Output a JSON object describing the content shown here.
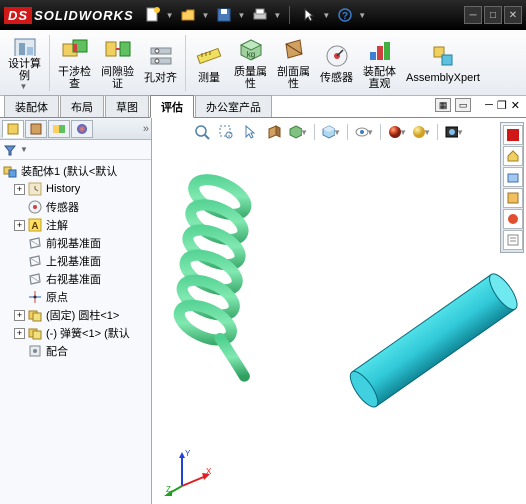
{
  "app": {
    "name": "SOLIDWORKS"
  },
  "ribbon": {
    "items": [
      {
        "label": "设计算\n例"
      },
      {
        "label": "干涉检\n查"
      },
      {
        "label": "间隙验\n证"
      },
      {
        "label": "孔对齐"
      },
      {
        "label": "测量"
      },
      {
        "label": "质量属\n性"
      },
      {
        "label": "剖面属\n性"
      },
      {
        "label": "传感器"
      },
      {
        "label": "装配体\n直观"
      },
      {
        "label": "AssemblyXpert"
      }
    ]
  },
  "tabs": {
    "items": [
      "装配体",
      "布局",
      "草图",
      "评估",
      "办公室产品"
    ],
    "active": 3
  },
  "tree": {
    "root": "装配体1 (默认<默认",
    "nodes": [
      {
        "icon": "history",
        "label": "History",
        "exp": "+",
        "ind": 1
      },
      {
        "icon": "sensor",
        "label": "传感器",
        "ind": 1
      },
      {
        "icon": "annot",
        "label": "注解",
        "exp": "+",
        "ind": 1
      },
      {
        "icon": "plane",
        "label": "前视基准面",
        "ind": 1
      },
      {
        "icon": "plane",
        "label": "上视基准面",
        "ind": 1
      },
      {
        "icon": "plane",
        "label": "右视基准面",
        "ind": 1
      },
      {
        "icon": "origin",
        "label": "原点",
        "ind": 1
      },
      {
        "icon": "part",
        "label": "(固定) 圆柱<1>",
        "exp": "+",
        "ind": 1
      },
      {
        "icon": "part",
        "label": "(-) 弹簧<1> (默认",
        "exp": "+",
        "ind": 1
      },
      {
        "icon": "mate",
        "label": "配合",
        "ind": 1
      }
    ]
  }
}
